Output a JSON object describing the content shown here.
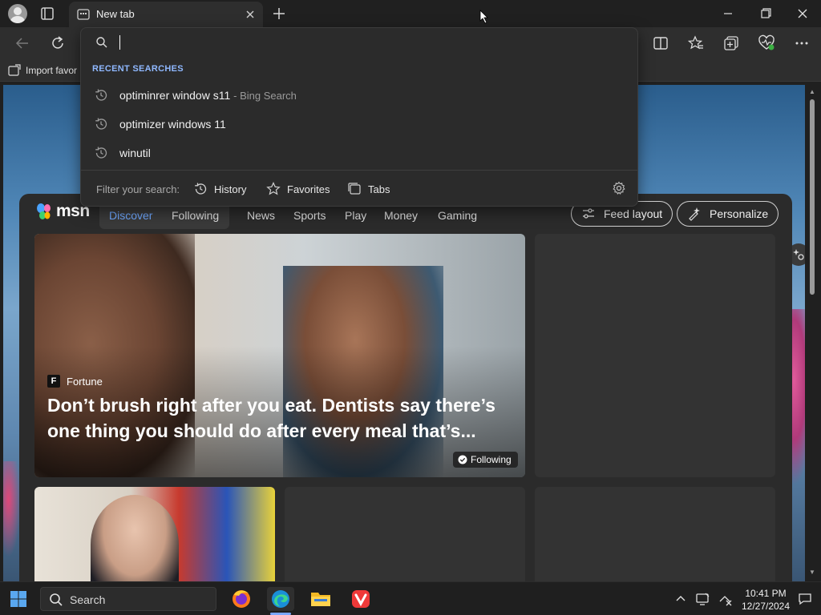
{
  "browser": {
    "tab_title": "New tab",
    "favorites_bar": {
      "import_label": "Import favor"
    }
  },
  "omnibox": {
    "input_value": "",
    "recent_header": "RECENT SEARCHES",
    "suggestions": [
      {
        "text": "optiminrer window s11",
        "suffix": "- Bing Search"
      },
      {
        "text": "optimizer windows 11",
        "suffix": ""
      },
      {
        "text": "winutil",
        "suffix": ""
      }
    ],
    "filter_label": "Filter your search:",
    "filters": [
      "History",
      "Favorites",
      "Tabs"
    ]
  },
  "feed": {
    "logo_text": "msn",
    "nav": [
      "Discover",
      "Following",
      "News",
      "Sports",
      "Play",
      "Money",
      "Gaming"
    ],
    "more": "···",
    "feed_layout_label": "Feed layout",
    "personalize_label": "Personalize",
    "hero": {
      "source_initial": "F",
      "source": "Fortune",
      "title": "Don’t brush right after you eat. Dentists say there’s one thing you should do after every meal that’s...",
      "following_label": "Following"
    }
  },
  "taskbar": {
    "search_label": "Search",
    "time": "10:41 PM",
    "date": "12/27/2024"
  },
  "colors": {
    "accent_blue": "#6fa8ff",
    "recent_header": "#8fb8ff",
    "background": "#202020"
  }
}
